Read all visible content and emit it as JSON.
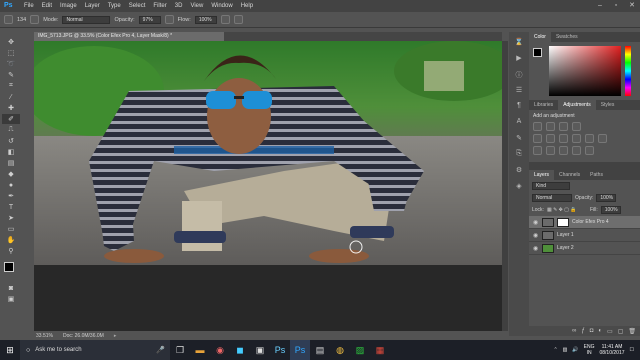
{
  "app": {
    "logo": "Ps"
  },
  "menu": [
    "File",
    "Edit",
    "Image",
    "Layer",
    "Type",
    "Select",
    "Filter",
    "3D",
    "View",
    "Window",
    "Help"
  ],
  "options": {
    "mode_label": "Mode:",
    "mode_value": "Normal",
    "opacity_label": "Opacity:",
    "opacity_value": "97%",
    "flow_label": "Flow:",
    "flow_value": "100%",
    "brush_size": "134"
  },
  "document": {
    "tab_title": "IMG_5713.JPG @ 33.5% (Color Efex Pro 4, Layer Mask/8) *",
    "zoom": "33.51%",
    "doc_info": "Doc: 26.0M/36.0M"
  },
  "panels": {
    "color_tabs": [
      "Color",
      "Swatches"
    ],
    "adj_tabs": [
      "Libraries",
      "Adjustments",
      "Styles"
    ],
    "adj_hint": "Add an adjustment",
    "layers_tabs": [
      "Layers",
      "Channels",
      "Paths"
    ],
    "kind_label": "Kind",
    "blend_mode": "Normal",
    "opacity_label": "Opacity:",
    "opacity_value": "100%",
    "lock_label": "Lock:",
    "fill_label": "Fill:",
    "fill_value": "100%",
    "layers": [
      {
        "name": "Color Efex Pro 4",
        "selected": true
      },
      {
        "name": "Layer 1",
        "selected": false
      },
      {
        "name": "Layer 2",
        "selected": false
      }
    ]
  },
  "taskbar": {
    "search_placeholder": "Ask me to search",
    "lang_top": "ENG",
    "lang_bottom": "IN",
    "time": "11:41 AM",
    "date": "08/10/2017"
  },
  "colors": {
    "accent": "#31a8ff",
    "panel": "#535353",
    "dark": "#282828"
  }
}
